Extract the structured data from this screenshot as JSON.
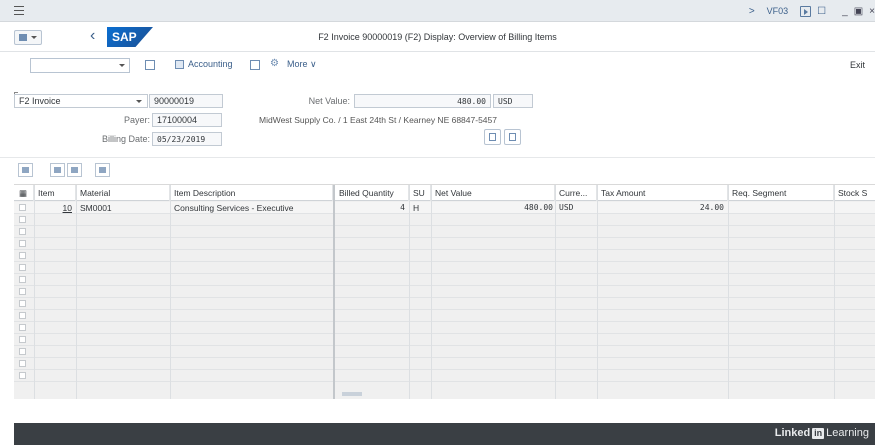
{
  "system_bar": {
    "tcode": "VF03"
  },
  "title_bar": {
    "logo_text": "SAP",
    "title": "F2 Invoice 90000019  (F2) Display: Overview of Billing Items"
  },
  "toolbar": {
    "accounting_label": "Accounting",
    "more_label": "More",
    "exit_label": "Exit"
  },
  "header": {
    "doc_type": "F2 Invoice",
    "doc_number": "90000019",
    "payer_label": "Payer:",
    "payer_value": "17100004",
    "billing_date_label": "Billing Date:",
    "billing_date_value": "05/23/2019",
    "net_value_label": "Net Value:",
    "net_value": "480.00",
    "currency": "USD",
    "payer_address": "MidWest Supply Co. / 1 East 24th St / Kearney NE 68847-5457"
  },
  "table": {
    "columns": [
      "Item",
      "Material",
      "Item Description",
      "Billed Quantity",
      "SU",
      "Net Value",
      "Curre...",
      "Tax Amount",
      "Req. Segment",
      "Stock S"
    ],
    "rows": [
      {
        "item": "10",
        "material": "SM0001",
        "description": "Consulting Services - Executive",
        "quantity": "4",
        "su": "H",
        "net_value": "480.00",
        "currency": "USD",
        "tax_amount": "24.00",
        "req_segment": "",
        "stock_segment": ""
      }
    ],
    "empty_rows": 14
  },
  "banner": {
    "brand_a": "Linked",
    "brand_in": "in",
    "brand_b": "Learning"
  }
}
